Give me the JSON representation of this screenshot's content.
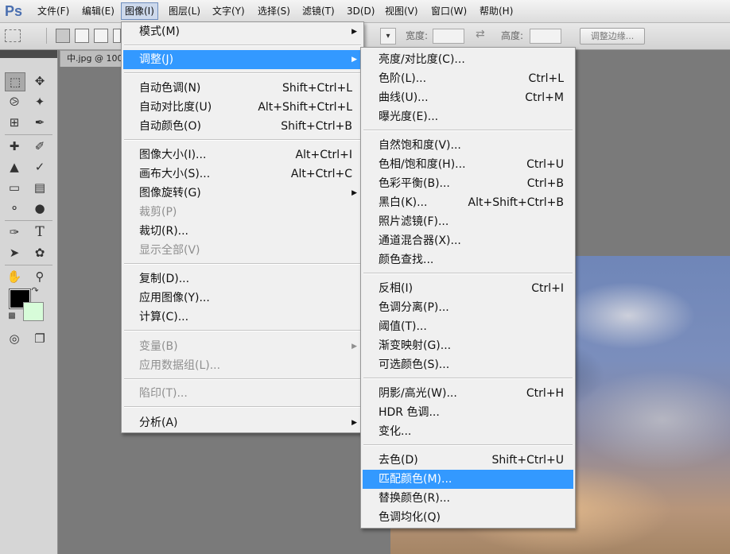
{
  "app": {
    "logo": "Ps"
  },
  "menubar": [
    {
      "label": "文件(F)"
    },
    {
      "label": "编辑(E)"
    },
    {
      "label": "图像(I)"
    },
    {
      "label": "图层(L)"
    },
    {
      "label": "文字(Y)"
    },
    {
      "label": "选择(S)"
    },
    {
      "label": "滤镜(T)"
    },
    {
      "label": "3D(D)"
    },
    {
      "label": "视图(V)"
    },
    {
      "label": "窗口(W)"
    },
    {
      "label": "帮助(H)"
    }
  ],
  "options_bar": {
    "width_label": "宽度:",
    "height_label": "高度:",
    "refine_edge": "调整边缘..."
  },
  "document": {
    "tab_title": "中.jpg @ 100"
  },
  "image_menu": {
    "items": [
      {
        "label": "模式(M)",
        "shortcut": "",
        "submenu": true,
        "disabled": false
      },
      {
        "label": "调整(J)",
        "shortcut": "",
        "submenu": true,
        "disabled": false
      },
      {
        "label": "自动色调(N)",
        "shortcut": "Shift+Ctrl+L",
        "submenu": false,
        "disabled": false
      },
      {
        "label": "自动对比度(U)",
        "shortcut": "Alt+Shift+Ctrl+L",
        "submenu": false,
        "disabled": false
      },
      {
        "label": "自动颜色(O)",
        "shortcut": "Shift+Ctrl+B",
        "submenu": false,
        "disabled": false
      },
      {
        "label": "图像大小(I)...",
        "shortcut": "Alt+Ctrl+I",
        "submenu": false,
        "disabled": false
      },
      {
        "label": "画布大小(S)...",
        "shortcut": "Alt+Ctrl+C",
        "submenu": false,
        "disabled": false
      },
      {
        "label": "图像旋转(G)",
        "shortcut": "",
        "submenu": true,
        "disabled": false
      },
      {
        "label": "裁剪(P)",
        "shortcut": "",
        "submenu": false,
        "disabled": true
      },
      {
        "label": "裁切(R)...",
        "shortcut": "",
        "submenu": false,
        "disabled": false
      },
      {
        "label": "显示全部(V)",
        "shortcut": "",
        "submenu": false,
        "disabled": true
      },
      {
        "label": "复制(D)...",
        "shortcut": "",
        "submenu": false,
        "disabled": false
      },
      {
        "label": "应用图像(Y)...",
        "shortcut": "",
        "submenu": false,
        "disabled": false
      },
      {
        "label": "计算(C)...",
        "shortcut": "",
        "submenu": false,
        "disabled": false
      },
      {
        "label": "变量(B)",
        "shortcut": "",
        "submenu": true,
        "disabled": true
      },
      {
        "label": "应用数据组(L)...",
        "shortcut": "",
        "submenu": false,
        "disabled": true
      },
      {
        "label": "陷印(T)...",
        "shortcut": "",
        "submenu": false,
        "disabled": true
      },
      {
        "label": "分析(A)",
        "shortcut": "",
        "submenu": true,
        "disabled": false
      }
    ]
  },
  "adjust_menu": {
    "items": [
      {
        "label": "亮度/对比度(C)...",
        "shortcut": ""
      },
      {
        "label": "色阶(L)...",
        "shortcut": "Ctrl+L"
      },
      {
        "label": "曲线(U)...",
        "shortcut": "Ctrl+M"
      },
      {
        "label": "曝光度(E)...",
        "shortcut": ""
      },
      {
        "label": "自然饱和度(V)...",
        "shortcut": ""
      },
      {
        "label": "色相/饱和度(H)...",
        "shortcut": "Ctrl+U"
      },
      {
        "label": "色彩平衡(B)...",
        "shortcut": "Ctrl+B"
      },
      {
        "label": "黑白(K)...",
        "shortcut": "Alt+Shift+Ctrl+B"
      },
      {
        "label": "照片滤镜(F)...",
        "shortcut": ""
      },
      {
        "label": "通道混合器(X)...",
        "shortcut": ""
      },
      {
        "label": "颜色查找...",
        "shortcut": ""
      },
      {
        "label": "反相(I)",
        "shortcut": "Ctrl+I"
      },
      {
        "label": "色调分离(P)...",
        "shortcut": ""
      },
      {
        "label": "阈值(T)...",
        "shortcut": ""
      },
      {
        "label": "渐变映射(G)...",
        "shortcut": ""
      },
      {
        "label": "可选颜色(S)...",
        "shortcut": ""
      },
      {
        "label": "阴影/高光(W)...",
        "shortcut": "Ctrl+H"
      },
      {
        "label": "HDR 色调...",
        "shortcut": ""
      },
      {
        "label": "变化...",
        "shortcut": ""
      },
      {
        "label": "去色(D)",
        "shortcut": "Shift+Ctrl+U"
      },
      {
        "label": "匹配颜色(M)...",
        "shortcut": ""
      },
      {
        "label": "替换颜色(R)...",
        "shortcut": ""
      },
      {
        "label": "色调均化(Q)",
        "shortcut": ""
      }
    ]
  },
  "colors": {
    "highlight": "#3399ff",
    "foreground": "#000000",
    "background": "#d7fcd9"
  }
}
